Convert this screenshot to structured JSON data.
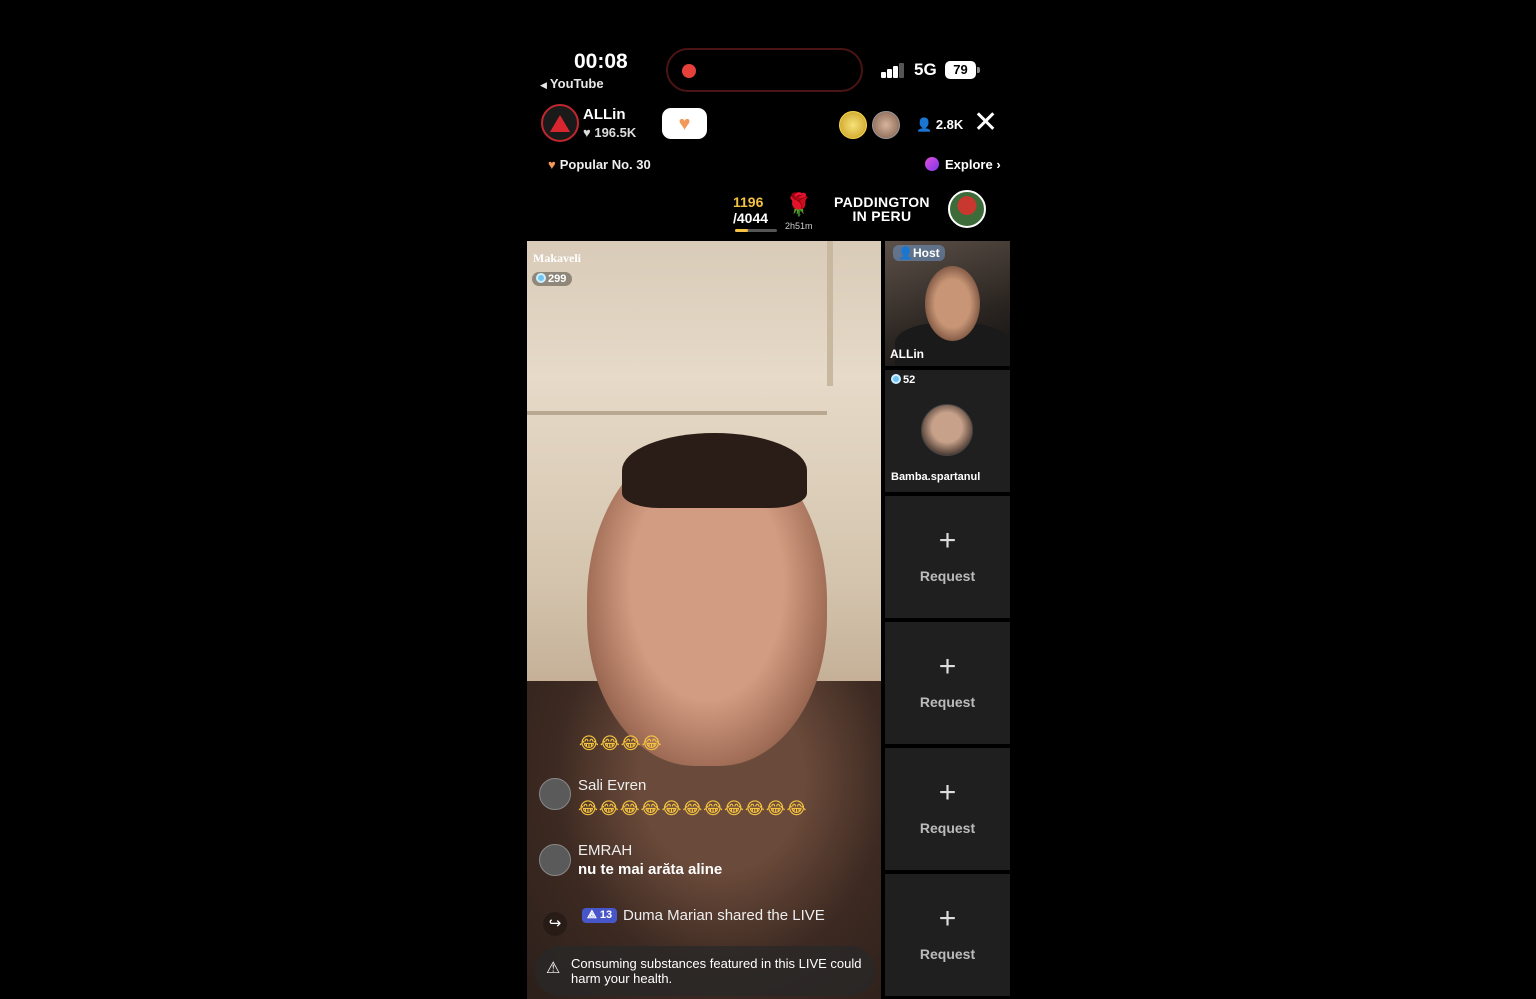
{
  "status_bar": {
    "time": "00:08",
    "back_app": "YouTube",
    "network": "5G",
    "battery": "79"
  },
  "header": {
    "host_name": "ALLin",
    "host_likes": "196.5K",
    "viewers": "2.8K",
    "popular": "Popular No. 30",
    "explore": "Explore"
  },
  "goal": {
    "current": "1196",
    "target": "/4044",
    "progress": 0.3,
    "rose_timer": "2h51m"
  },
  "promo": {
    "line1": "PADDINGTON",
    "line2": "IN PERU"
  },
  "main_stream": {
    "name": "Makaveli",
    "count": "299"
  },
  "chat": {
    "floating_emojis": "😂😂😂😂",
    "messages": [
      {
        "user": "Sali Evren",
        "text": "😂😂😂😂😂😂😂😂😂😂😂"
      },
      {
        "user": "EMRAH",
        "text": "nu te mai arăta aline"
      }
    ],
    "share_level": "13",
    "share_text": "Duma Marian shared the LIVE"
  },
  "warning": "Consuming substances featured in this LIVE could harm your health.",
  "side_panel": {
    "host_badge": "Host",
    "host_label": "ALLin",
    "guest_count": "52",
    "guest_name": "Bamba.spartanul",
    "request_label": "Request"
  },
  "colors": {
    "accent_heart": "#f2995a",
    "record_dot": "#e5413a",
    "goal_gold": "#f6c244"
  }
}
